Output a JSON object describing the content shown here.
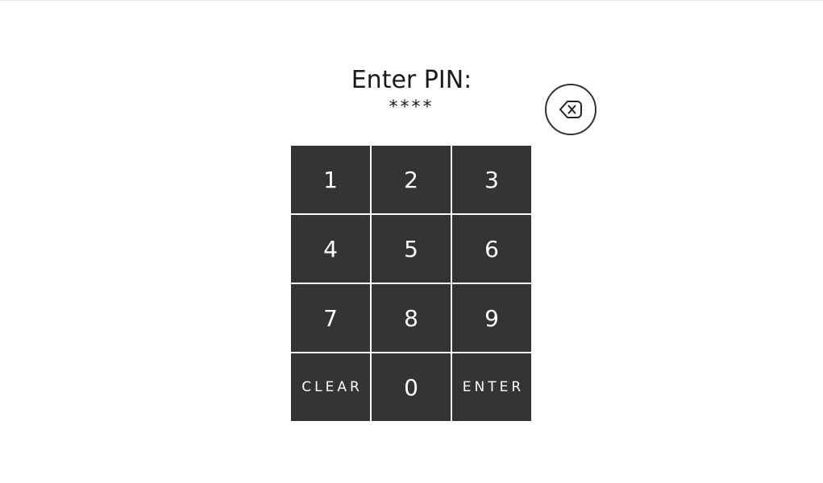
{
  "prompt": {
    "title": "Enter PIN:",
    "masked_pin": "****"
  },
  "backspace": {
    "icon": "backspace-icon"
  },
  "keypad": {
    "keys": [
      "1",
      "2",
      "3",
      "4",
      "5",
      "6",
      "7",
      "8",
      "9",
      "CLEAR",
      "0",
      "ENTER"
    ]
  },
  "colors": {
    "key_background": "#333436",
    "key_text": "#ffffff",
    "page_background": "#ffffff",
    "text": "#1a1a1a"
  }
}
